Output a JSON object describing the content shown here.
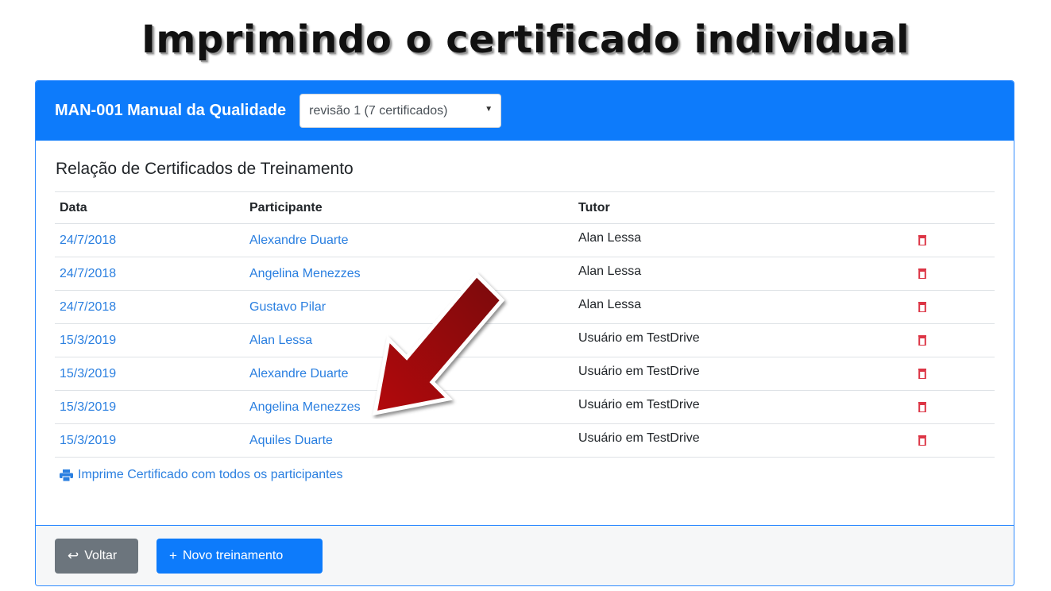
{
  "headline": "Imprimindo o certificado individual",
  "header": {
    "title": "MAN-001 Manual da Qualidade",
    "revision_select": "revisão 1 (7 certificados)"
  },
  "section_title": "Relação de Certificados de Treinamento",
  "table": {
    "columns": [
      "Data",
      "Participante",
      "Tutor"
    ],
    "rows": [
      {
        "date": "24/7/2018",
        "participant": "Alexandre Duarte",
        "tutor": "Alan Lessa"
      },
      {
        "date": "24/7/2018",
        "participant": "Angelina Menezzes",
        "tutor": "Alan Lessa"
      },
      {
        "date": "24/7/2018",
        "participant": "Gustavo Pilar",
        "tutor": "Alan Lessa"
      },
      {
        "date": "15/3/2019",
        "participant": "Alan Lessa",
        "tutor": "Usuário em TestDrive"
      },
      {
        "date": "15/3/2019",
        "participant": "Alexandre Duarte",
        "tutor": "Usuário em TestDrive"
      },
      {
        "date": "15/3/2019",
        "participant": "Angelina Menezzes",
        "tutor": "Usuário em TestDrive"
      },
      {
        "date": "15/3/2019",
        "participant": "Aquiles Duarte",
        "tutor": "Usuário em TestDrive"
      }
    ]
  },
  "print_all_label": "Imprime Certificado com todos os participantes",
  "footer": {
    "back_label": "Voltar",
    "new_label": "Novo treinamento"
  },
  "colors": {
    "primary": "#0d7bfb",
    "link": "#2a7fe0",
    "danger": "#dc3545",
    "secondary": "#6c757d",
    "arrow": "#a80f12"
  },
  "icons": {
    "row_action": "trash-icon",
    "print": "printer-icon",
    "back": "return-arrow-icon",
    "new": "plus-icon",
    "select": "caret-down-icon",
    "callout": "arrow-pointer-icon"
  }
}
